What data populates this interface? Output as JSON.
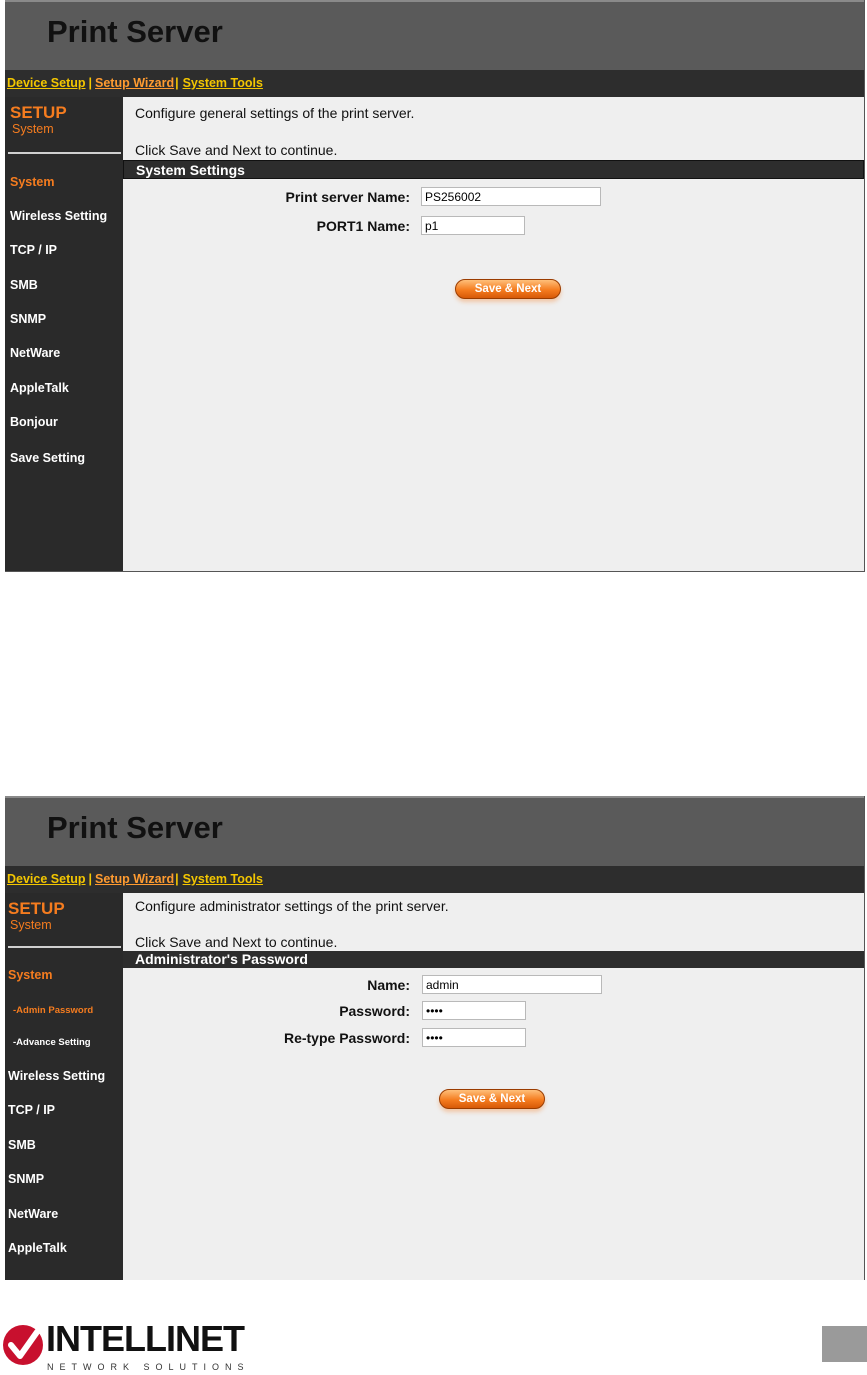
{
  "app_title": "Print Server",
  "nav": {
    "device_setup": "Device Setup",
    "setup_wizard": "Setup Wizard",
    "system_tools": "System Tools"
  },
  "side": {
    "setup": "SETUP",
    "subtitle": "System"
  },
  "screen1": {
    "menu": [
      "System",
      "Wireless Setting",
      "TCP / IP",
      "SMB",
      "SNMP",
      "NetWare",
      "AppleTalk",
      "Bonjour",
      "Save Setting"
    ],
    "intro": "Configure general settings of the print server.",
    "instruction": "Click Save and Next to continue.",
    "section": "System Settings",
    "fields": {
      "server_name_label": "Print server Name:",
      "server_name_value": "PS256002",
      "port1_label": "PORT1 Name:",
      "port1_value": "p1"
    },
    "save_button": "Save & Next"
  },
  "screen2": {
    "menu_top": "System",
    "sub_items": [
      "-Admin Password",
      "-Advance Setting"
    ],
    "menu": [
      "Wireless Setting",
      "TCP / IP",
      "SMB",
      "SNMP",
      "NetWare",
      "AppleTalk"
    ],
    "intro": "Configure administrator settings of the print server.",
    "instruction": "Click Save and Next to continue.",
    "section": "Administrator's Password",
    "fields": {
      "name_label": "Name:",
      "name_value": "admin",
      "password_label": "Password:",
      "password_value": "••••",
      "retype_label": "Re-type Password:",
      "retype_value": "••••"
    },
    "save_button": "Save & Next"
  },
  "footer": {
    "brand": "INTELLINET",
    "tagline": "NETWORK SOLUTIONS"
  },
  "colors": {
    "accent": "#f57c1f",
    "nav_link": "#f3c600",
    "sidebar": "#2a2a2a",
    "header": "#5a5a5a"
  }
}
